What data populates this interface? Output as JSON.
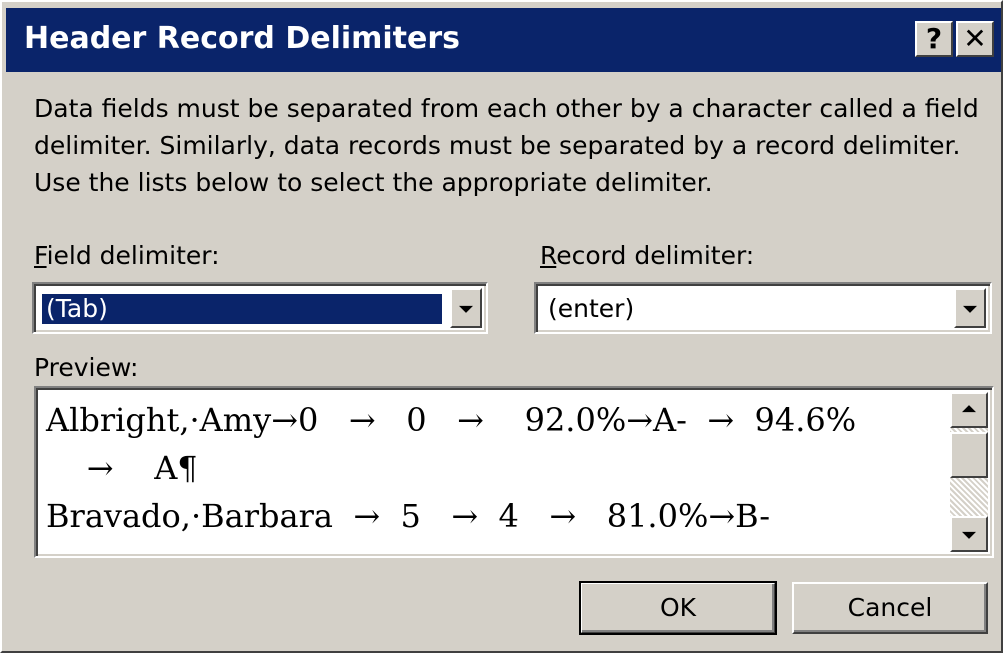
{
  "window": {
    "title": "Header Record Delimiters",
    "help_label": "?",
    "close_label": "✕"
  },
  "description": "Data fields must be separated from each other by a character called a field delimiter. Similarly, data records must be separated by a record delimiter. Use the lists below to select the appropriate delimiter.",
  "field_delimiter": {
    "label_mnemonic": "F",
    "label_rest": "ield delimiter:",
    "value": "(Tab)"
  },
  "record_delimiter": {
    "label_mnemonic": "R",
    "label_rest": "ecord delimiter:",
    "value": "(enter)"
  },
  "preview": {
    "label": "Preview:",
    "lines": [
      "Albright,·Amy→0   →   0   →    92.0%→A-  →  94.6%",
      "    →    A¶",
      "Bravado,·Barbara  →  5   →  4   →   81.0%→B-"
    ]
  },
  "buttons": {
    "ok": "OK",
    "cancel": "Cancel"
  }
}
